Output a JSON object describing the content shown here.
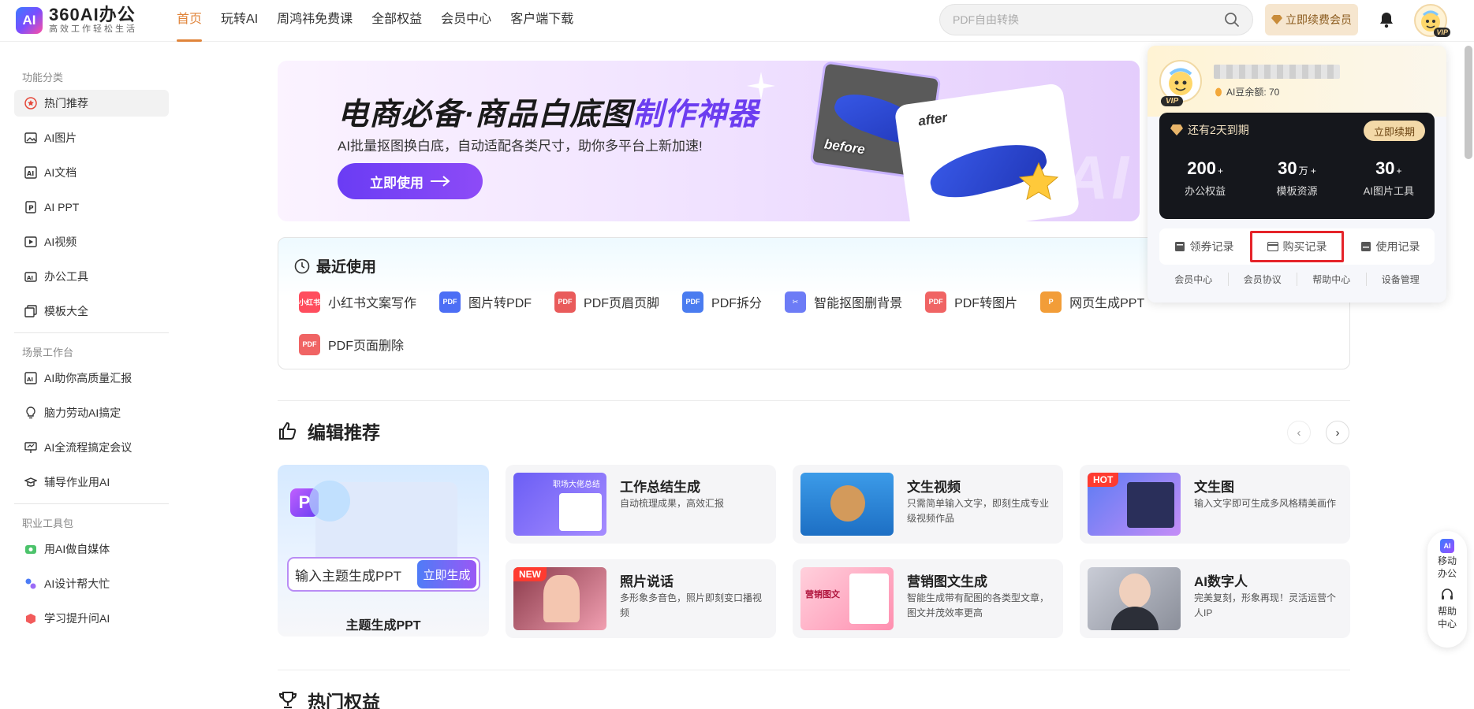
{
  "header": {
    "logo_mark": "AI",
    "logo_name": "360AI办公",
    "logo_slogan": "高效工作轻松生活",
    "nav": [
      "首页",
      "玩转AI",
      "周鸿祎免费课",
      "全部权益",
      "会员中心",
      "客户端下载"
    ],
    "search_placeholder": "PDF自由转换",
    "vip_button": "立即续费会员",
    "avatar_vip": "VIP"
  },
  "sidebar": {
    "groups": [
      {
        "title": "功能分类",
        "items": [
          "热门推荐",
          "AI图片",
          "AI文档",
          "AI PPT",
          "AI视频",
          "办公工具",
          "模板大全"
        ]
      },
      {
        "title": "场景工作台",
        "items": [
          "AI助你高质量汇报",
          "脑力劳动AI搞定",
          "AI全流程搞定会议",
          "辅导作业用AI"
        ]
      },
      {
        "title": "职业工具包",
        "items": [
          "用AI做自媒体",
          "AI设计帮大忙",
          "学习提升问AI"
        ]
      }
    ]
  },
  "banner": {
    "title_main": "电商必备·商品白底图",
    "title_highlight": "制作神器",
    "subtitle": "AI批量抠图换白底，自动适配各类尺寸，助你多平台上新加速!",
    "cta": "立即使用",
    "tag_before": "before",
    "tag_after": "after",
    "watermark": "360 AI"
  },
  "recent": {
    "title": "最近使用",
    "items": [
      {
        "label": "小红书文案写作",
        "color": "#ff4d5e"
      },
      {
        "label": "图片转PDF",
        "color": "#4c6ef5"
      },
      {
        "label": "PDF页眉页脚",
        "color": "#e95b5b"
      },
      {
        "label": "PDF拆分",
        "color": "#4a7cf0"
      },
      {
        "label": "智能抠图删背景",
        "color": "#6d7cf6"
      },
      {
        "label": "PDF转图片",
        "color": "#f06464"
      },
      {
        "label": "网页生成PPT",
        "color": "#f29d38"
      },
      {
        "label": "PDF页面删除",
        "color": "#f06464"
      }
    ]
  },
  "editor": {
    "title": "编辑推荐",
    "ppt": {
      "placeholder": "输入主题生成PPT",
      "button": "立即生成",
      "label": "主题生成PPT",
      "badge": "P"
    },
    "features": [
      {
        "title": "工作总结生成",
        "desc": "自动梳理成果，高效汇报",
        "badge": "",
        "thumb_text": "职场大佬总结"
      },
      {
        "title": "文生视频",
        "desc": "只需简单输入文字，即刻生成专业级视频作品",
        "badge": "",
        "thumb_text": ""
      },
      {
        "title": "文生图",
        "desc": "输入文字即可生成多风格精美画作",
        "badge": "HOT",
        "thumb_text": ""
      },
      {
        "title": "照片说话",
        "desc": "多形象多音色，照片即刻变口播视频",
        "badge": "NEW",
        "thumb_text": ""
      },
      {
        "title": "营销图文生成",
        "desc": "智能生成带有配图的各类型文章，图文并茂效率更高",
        "badge": "",
        "thumb_text": "营销图文"
      },
      {
        "title": "AI数字人",
        "desc": "完美复刻，形象再现！灵活运营个人IP",
        "badge": "",
        "thumb_text": ""
      }
    ]
  },
  "hot": {
    "title": "热门权益"
  },
  "popover": {
    "beans": "AI豆余额: 70",
    "vip": "VIP",
    "expire": "还有2天到期",
    "renew": "立即续期",
    "stats": [
      {
        "num": "200",
        "unit": "+",
        "label": "办公权益"
      },
      {
        "num": "30",
        "unit": "万 +",
        "label": "模板资源"
      },
      {
        "num": "30",
        "unit": "+",
        "label": "AI图片工具"
      }
    ],
    "links": [
      "领券记录",
      "购买记录",
      "使用记录"
    ],
    "footer": [
      "会员中心",
      "会员协议",
      "帮助中心",
      "设备管理"
    ]
  },
  "float": {
    "top": "移动办公",
    "bottom": "帮助中心",
    "badge": "AI"
  },
  "colors": {
    "accent": "#e0843a",
    "brand_purple": "#6c3df0",
    "highlight_red": "#e5242a"
  }
}
